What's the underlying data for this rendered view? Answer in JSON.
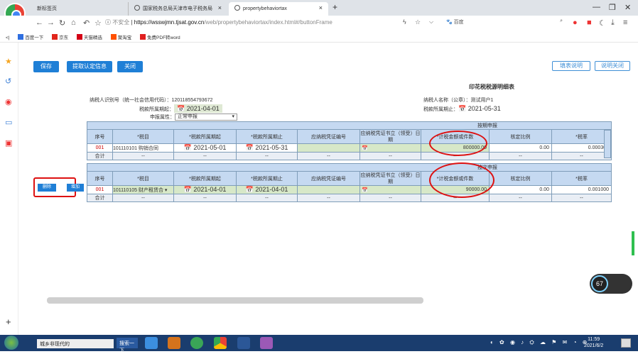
{
  "browser": {
    "tabs": [
      {
        "label": "新标签页"
      },
      {
        "label": "国家税务总局天津市电子税务局"
      },
      {
        "label": "propertybehaviortax"
      }
    ],
    "url_insecure": "不安全",
    "url_domain": "https://wsswjmn.tjsat.gov.cn",
    "url_path": "/web/propertybehaviortax/index.html#/buttonFrame",
    "search_placeholder": "百度"
  },
  "bookmarks": [
    "百度一下",
    "京东",
    "天猫精选",
    "聚淘宝",
    "免费PDF转word"
  ],
  "toolbar": {
    "save": "保存",
    "fetch": "提取认定信息",
    "close": "关闭",
    "help": "填表说明",
    "help_close": "说明关闭"
  },
  "form": {
    "title": "印花税税源明细表",
    "taxpayer_id_label": "纳税人识别号（统一社会信用代码）：",
    "taxpayer_id": "120118554793672",
    "taxpayer_name_label": "纳税人名称（公章）：",
    "taxpayer_name": "测试用户1",
    "period_start_label": "税款所属期起：",
    "period_start": "2021-04-01",
    "period_end_label": "税款所属期止：",
    "period_end": "2021-05-31",
    "attr_label": "申报属性：",
    "attr_value": "正常申报"
  },
  "table": {
    "section1": "按期申报",
    "section2": "按次申报",
    "headers": [
      "序号",
      "*税目",
      "*税款所属期起",
      "*税款所属期止",
      "应纳税凭证编号",
      "应纳税凭证书立（领受）日期",
      "*计税金额或件数",
      "核定比例",
      "*税率"
    ],
    "row1": {
      "no": "001",
      "item": "101110101 购销合同",
      "start": "2021-05-01",
      "end": "2021-05-31",
      "amount": "800000.00",
      "ratio": "0.00",
      "rate": "0.000300"
    },
    "row2": {
      "no": "001",
      "item": "101110105 财产租赁合 ▾",
      "start": "2021-04-01",
      "end": "2021-04-01",
      "amount": "90000.00",
      "ratio": "0.00",
      "rate": "0.001000"
    },
    "total": "合计",
    "dash": "--",
    "btn_delete": "删除",
    "btn_add": "增加"
  },
  "speed": "67",
  "taskbar": {
    "item": "城乡非现代的",
    "search": "搜索一下",
    "time": "11:59",
    "date": "2021/6/2"
  }
}
